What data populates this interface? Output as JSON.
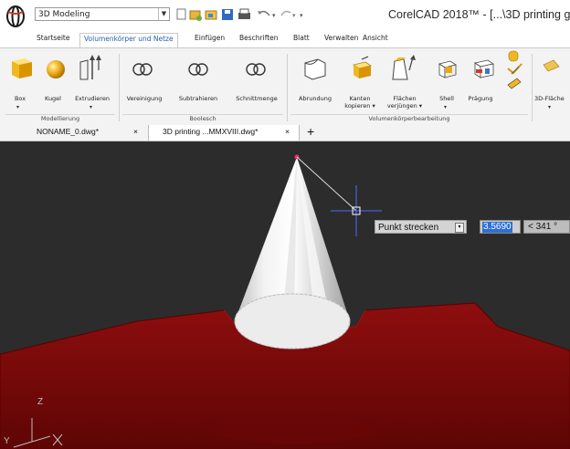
{
  "app": {
    "title": "CorelCAD 2018™ - [...\\3D printing g",
    "workspace": "3D Modeling"
  },
  "ribbon_tabs": [
    "Startseite",
    "Volumenkörper und Netze",
    "Einfügen",
    "Beschriften",
    "Blatt",
    "Verwalten",
    "Ansicht"
  ],
  "active_tab": "Volumenkörper und Netze",
  "ribbon": {
    "modellierung": {
      "label": "Modellierung",
      "box": "Box",
      "kugel": "Kugel",
      "extrudieren": "Extrudieren"
    },
    "boolesch": {
      "label": "Boolesch",
      "vereinigung": "Vereinigung",
      "subtrahieren": "Subtrahieren",
      "schnittmenge": "Schnittmenge"
    },
    "bearbeitung": {
      "label": "Volumenkörperbearbeitung",
      "abrundung": "Abrundung",
      "kanten_1": "Kanten",
      "kanten_2": "kopieren",
      "flaechen_1": "Flächen",
      "flaechen_2": "verjüngen",
      "shell": "Shell",
      "praegung": "Prägung"
    },
    "extra": {
      "flaeche3d": "3D-Fläche"
    }
  },
  "doc_tabs": [
    {
      "name": "NONAME_0.dwg*",
      "close": "×"
    },
    {
      "name": "3D printing ...MMXVIII.dwg*",
      "close": "×"
    }
  ],
  "new_tab_symbol": "+",
  "command_input": {
    "label": "Punkt strecken",
    "value": "3.5690",
    "angle": "< 341 °"
  },
  "axes": {
    "x": "X",
    "y": "Y",
    "z": "Z"
  },
  "colors": {
    "ribbon_bg": "#f3f3f3",
    "viewport_bg": "#2c2c2c",
    "model_red": "#7a0a0a",
    "selection_blue": "#2d6fd6"
  }
}
